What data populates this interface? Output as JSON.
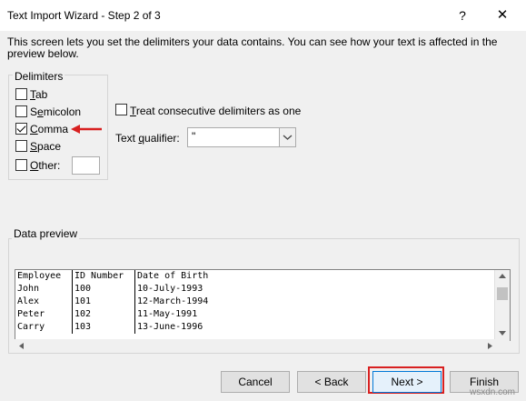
{
  "window": {
    "title": "Text Import Wizard - Step 2 of 3",
    "help_label": "?",
    "close_label": "✕"
  },
  "description": "This screen lets you set the delimiters your data contains.  You can see how your text is affected in the preview below.",
  "delimiters": {
    "group_label": "Delimiters",
    "items": [
      {
        "prefix": "",
        "mnemonic": "T",
        "rest": "ab",
        "checked": false
      },
      {
        "prefix": "S",
        "mnemonic": "e",
        "rest": "micolon",
        "checked": false
      },
      {
        "prefix": "",
        "mnemonic": "C",
        "rest": "omma",
        "checked": true
      },
      {
        "prefix": "",
        "mnemonic": "S",
        "rest": "pace",
        "checked": false
      },
      {
        "prefix": "",
        "mnemonic": "O",
        "rest": "ther:",
        "checked": false
      }
    ],
    "other_value": ""
  },
  "options": {
    "consecutive": {
      "mnemonic": "T",
      "rest": "reat consecutive delimiters as one",
      "checked": false
    },
    "qualifier": {
      "prefix": "Text ",
      "mnemonic": "q",
      "rest": "ualifier:",
      "value": "\""
    }
  },
  "preview": {
    "group_label": "Data preview",
    "group_mnemonic": "p",
    "rows": [
      [
        "Employee",
        "ID Number",
        "Date of Birth"
      ],
      [
        "John",
        "100",
        "10-July-1993"
      ],
      [
        "Alex",
        "101",
        "12-March-1994"
      ],
      [
        "Peter",
        "102",
        "11-May-1991"
      ],
      [
        "Carry",
        "103",
        "13-June-1996"
      ]
    ]
  },
  "buttons": {
    "cancel": "Cancel",
    "back": "< Back",
    "next": "Next >",
    "finish": "Finish"
  },
  "watermark": "wsxdn.com",
  "colors": {
    "highlight": "#d82020",
    "accent": "#0078d7"
  }
}
